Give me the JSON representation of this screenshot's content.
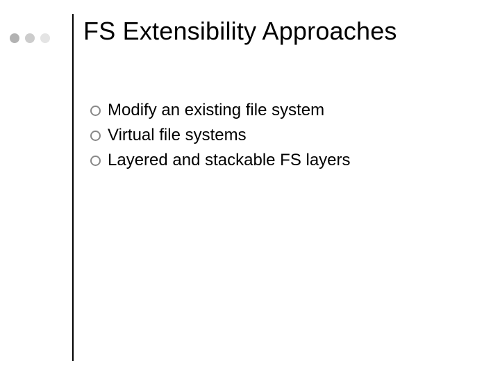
{
  "title": "FS Extensibility Approaches",
  "bullets": [
    "Modify an existing file system",
    "Virtual file systems",
    "Layered and stackable FS layers"
  ]
}
